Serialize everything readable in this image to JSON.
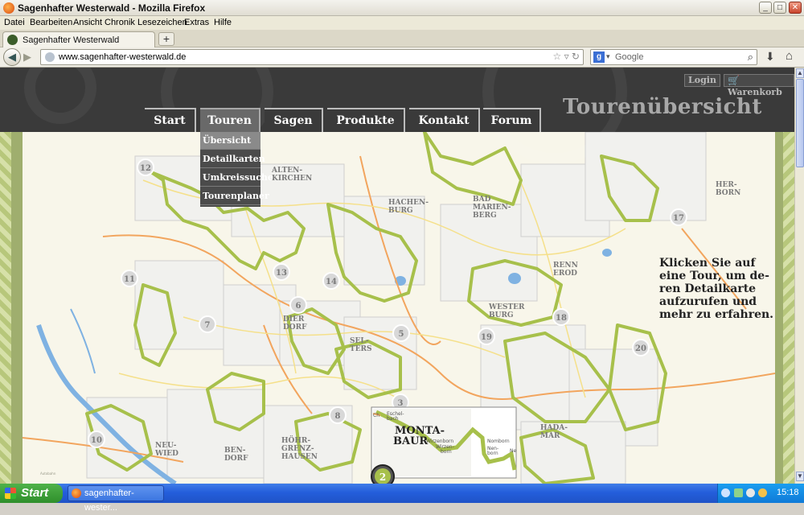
{
  "window": {
    "title": "Sagenhafter Westerwald - Mozilla Firefox",
    "minimize": "_",
    "maximize": "□",
    "close": "✕"
  },
  "menubar": [
    "Datei",
    "Bearbeiten",
    "Ansicht",
    "Chronik",
    "Lesezeichen",
    "Extras",
    "Hilfe"
  ],
  "tab": {
    "label": "Sagenhafter Westerwald",
    "new_tab": "+"
  },
  "navigation": {
    "url": "www.sagenhafter-westerwald.de",
    "search_engine": "Google",
    "search_placeholder": "Google"
  },
  "site": {
    "login": "Login",
    "cart": "Warenkorb",
    "heading": "Tourenübersicht",
    "nav": [
      "Start",
      "Touren",
      "Sagen",
      "Produkte",
      "Kontakt",
      "Forum"
    ],
    "active_nav": "Touren",
    "dropdown": [
      "Übersicht",
      "Detailkarten",
      "Umkreissuche",
      "Tourenplaner"
    ],
    "active_dropdown": "Übersicht",
    "info": [
      "Klicken Sie auf",
      "eine Tour, um de-",
      "ren Detailkarte",
      "aufzurufen und",
      "mehr zu erfahren."
    ]
  },
  "map": {
    "towns": [
      {
        "lines": [
          "ALTEN-",
          "KIRCHEN"
        ]
      },
      {
        "lines": [
          "HACHEN-",
          "BURG"
        ]
      },
      {
        "lines": [
          "BAD",
          "MARIEN-",
          "BERG"
        ]
      },
      {
        "lines": [
          "HER-",
          "BORN"
        ]
      },
      {
        "lines": [
          "RENN",
          "EROD"
        ]
      },
      {
        "lines": [
          "WESTER",
          "BURG"
        ]
      },
      {
        "lines": [
          "DIER",
          "DORF"
        ]
      },
      {
        "lines": [
          "SEL-",
          "TERS"
        ]
      },
      {
        "lines": [
          "HÖHR-",
          "GRENZ-",
          "HAUSEN"
        ]
      },
      {
        "lines": [
          "NEU-",
          "WIED"
        ]
      },
      {
        "lines": [
          "BEN-",
          "DORF"
        ]
      },
      {
        "lines": [
          "HADA-",
          "MAR"
        ]
      }
    ],
    "tours": [
      "12",
      "17",
      "11",
      "13",
      "14",
      "6",
      "7",
      "18",
      "5",
      "19",
      "20",
      "3",
      "8",
      "10",
      "2"
    ],
    "highlight": {
      "title_lines": [
        "MONTA-",
        "BAUR"
      ],
      "places": [
        "Eschel-",
        "bach",
        "Wirzenborn",
        "Wirzen-",
        "born",
        "Nomborn",
        "Nom-",
        "born",
        "Nen-",
        "born"
      ],
      "short": "Ch",
      "short2": "Ne"
    },
    "autobahn": "Autobahn"
  },
  "taskbar": {
    "start": "Start",
    "task": "sagenhafter-wester...",
    "clock": "15:18"
  },
  "colors": {
    "header": "#3a3a3a",
    "tour_green": "#a7c04b",
    "road_orange": "#f2a55e",
    "river_blue": "#7fb2e2",
    "badge": "#d8d8d8"
  }
}
